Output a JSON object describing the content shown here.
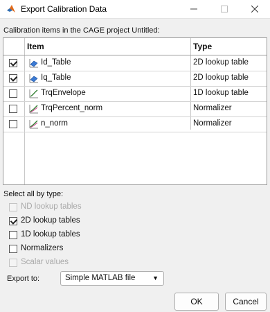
{
  "window": {
    "title": "Export Calibration Data"
  },
  "table": {
    "caption": "Calibration items in the CAGE project Untitled:",
    "headers": {
      "item": "Item",
      "type": "Type"
    },
    "rows": [
      {
        "checked": true,
        "name": "Id_Table",
        "type": "2D lookup table",
        "icon": "table-2d-icon"
      },
      {
        "checked": true,
        "name": "Iq_Table",
        "type": "2D lookup table",
        "icon": "table-2d-icon"
      },
      {
        "checked": false,
        "name": "TrqEnvelope",
        "type": "1D lookup table",
        "icon": "table-1d-icon"
      },
      {
        "checked": false,
        "name": "TrqPercent_norm",
        "type": "Normalizer",
        "icon": "normalizer-icon"
      },
      {
        "checked": false,
        "name": "n_norm",
        "type": "Normalizer",
        "icon": "normalizer-icon"
      }
    ]
  },
  "select_all": {
    "label": "Select all by type:",
    "options": [
      {
        "label": "ND lookup tables",
        "checked": false,
        "enabled": false
      },
      {
        "label": "2D lookup tables",
        "checked": true,
        "enabled": true
      },
      {
        "label": "1D lookup tables",
        "checked": false,
        "enabled": true
      },
      {
        "label": "Normalizers",
        "checked": false,
        "enabled": true
      },
      {
        "label": "Scalar values",
        "checked": false,
        "enabled": false
      }
    ]
  },
  "export": {
    "label": "Export to:",
    "value": "Simple MATLAB file"
  },
  "buttons": {
    "ok": "OK",
    "cancel": "Cancel"
  }
}
